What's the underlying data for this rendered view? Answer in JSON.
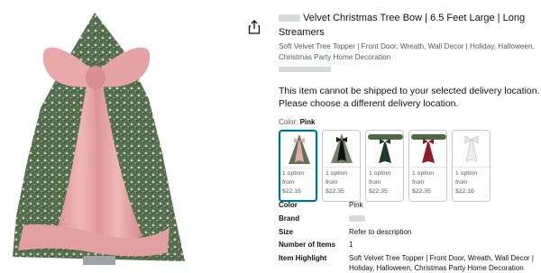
{
  "product": {
    "title": "Velvet Christmas Tree Bow | 6.5 Feet Large | Long Streamers",
    "subtitle": "Soft Velvet Tree Topper | Front Door, Wreath, Wall Decor | Holiday, Halloween, Christmas Party Home Decoration"
  },
  "shipping_message": "This item cannot be shipped to your selected delivery location. Please choose a different delivery location.",
  "color": {
    "label": "Color:",
    "selected": "Pink",
    "options": [
      {
        "option_text": "1 option from",
        "price": "$22.16",
        "icon": "pink-bow-on-tree"
      },
      {
        "option_text": "1 option from",
        "price": "$22.35",
        "icon": "black-bow-on-tree"
      },
      {
        "option_text": "1 option from",
        "price": "$22.35",
        "icon": "green-bow-on-tree"
      },
      {
        "option_text": "1 option from",
        "price": "$22.35",
        "icon": "red-bow-on-tree"
      },
      {
        "option_text": "1 option from",
        "price": "$22.16",
        "icon": "white-bow-on-tree"
      }
    ]
  },
  "details": [
    {
      "key": "Color",
      "value": "Pink"
    },
    {
      "key": "Brand",
      "value": ""
    },
    {
      "key": "Size",
      "value": "Refer to description"
    },
    {
      "key": "Number of Items",
      "value": "1"
    },
    {
      "key": "Item Highlight",
      "value": "Soft Velvet Tree Topper | Front Door, Wreath, Wall Decor | Holiday, Halloween, Christmas Party Home Decoration"
    }
  ],
  "colors": {
    "accent": "#007185",
    "bow_pink": "#e7a6a8",
    "tree_green": "#5d7352"
  }
}
